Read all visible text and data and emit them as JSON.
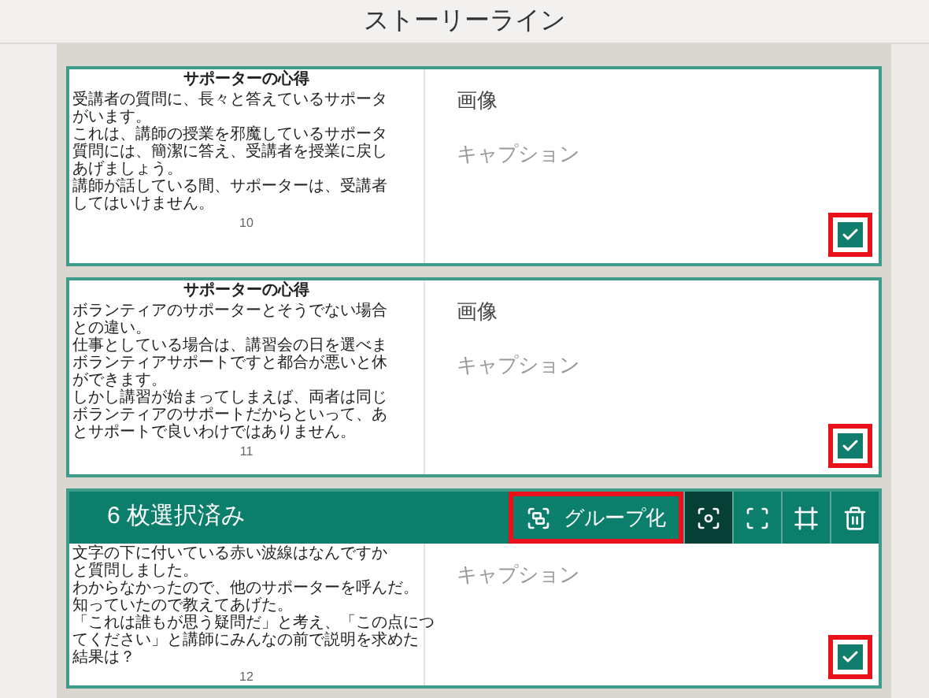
{
  "header": {
    "title": "ストーリーライン"
  },
  "cards": [
    {
      "thumbnail": {
        "title": "サポーターの心得",
        "lines": [
          "受講者の質問に、長々と答えているサポータ",
          "がいます。",
          "これは、講師の授業を邪魔しているサポータ",
          "質問には、簡潔に答え、受講者を授業に戻し",
          "あげましょう。",
          "講師が話している間、サポーターは、受講者",
          "してはいけません。"
        ],
        "page": "10"
      },
      "label": "画像",
      "caption_placeholder": "キャプション",
      "checked": true,
      "highlighted": true
    },
    {
      "thumbnail": {
        "title": "サポーターの心得",
        "lines": [
          "ボランティアのサポーターとそうでない場合",
          "との違い。",
          "仕事としている場合は、講習会の日を選べま",
          "ボランティアサポートですと都合が悪いと休",
          "ができます。",
          "しかし講習が始まってしまえば、両者は同じ",
          "ボランティアのサポートだからといって、あ",
          "とサポートで良いわけではありません。"
        ],
        "page": "11"
      },
      "label": "画像",
      "caption_placeholder": "キャプション",
      "checked": true,
      "highlighted": true
    },
    {
      "thumbnail": {
        "lines": [
          "文字の下に付いている赤い波線はなんですか",
          "と質問しました。",
          "わからなかったので、他のサポーターを呼んだ。",
          "知っていたので教えてあげた。",
          "「これは誰もが思う疑問だ」と考え、「この点につ",
          "てください」と講師にみんなの前で説明を求めた",
          "結果は？"
        ],
        "page": "12"
      },
      "caption_placeholder": "キャプション",
      "checked": true,
      "highlighted": true,
      "selection_bar": {
        "count": "6 枚選択済み",
        "group_button": {
          "label": "グループ化",
          "highlighted": true
        },
        "tools": [
          {
            "kind": "focus",
            "selected": true
          },
          {
            "kind": "frame",
            "selected": false
          },
          {
            "kind": "crop",
            "selected": false
          },
          {
            "kind": "delete",
            "selected": false
          }
        ]
      }
    }
  ]
}
